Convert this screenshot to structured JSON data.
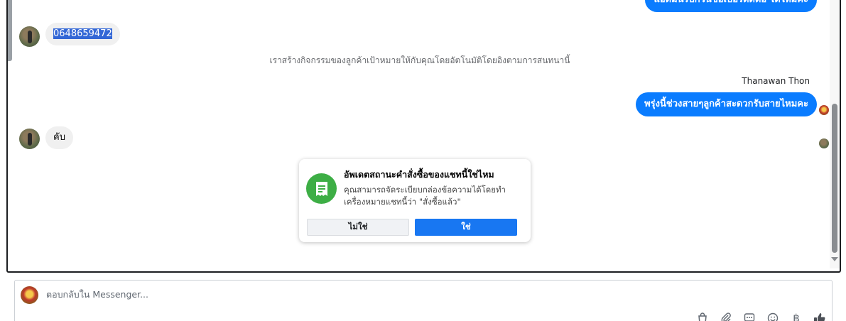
{
  "messages": {
    "out_top": "แอดมินรบกวนขอเบอร์ติดต่อ ได้ไหมคะ",
    "phone": "0648659472",
    "system_note": "เราสร้างกิจกรรมของลูกค้าเป้าหมายให้กับคุณโดยอัตโนมัติโดยอิงตามการสนทนานี้",
    "sender_name": "Thanawan Thon",
    "out_second": "พรุ่งนี้ช่วงสายๆลูกค้าสะดวกรับสายไหมคะ",
    "in_reply": "คับ"
  },
  "prompt": {
    "title": "อัพเดตสถานะคำสั่งซื้อของแชทนี้ใช่ไหม",
    "body": "คุณสามารถจัดระเบียบกล่องข้อความได้โดยทำเครื่องหมายแชทนี้ว่า \"สั่งซื้อแล้ว\"",
    "no_label": "ไม่ใช่",
    "yes_label": "ใช่",
    "icon": "order-receipt-icon",
    "icon_color": "#3dae45"
  },
  "composer": {
    "placeholder": "ตอบกลับใน Messenger..."
  },
  "toolbar": {
    "icons": [
      "bag-icon",
      "paperclip-icon",
      "saved-replies-icon",
      "emoji-icon",
      "baht-icon",
      "thumbs-up-icon"
    ],
    "baht_symbol": "฿"
  },
  "colors": {
    "outgoing_bubble": "#0a7cff",
    "incoming_bubble": "#f0f0f0",
    "primary_button": "#1877f2"
  }
}
